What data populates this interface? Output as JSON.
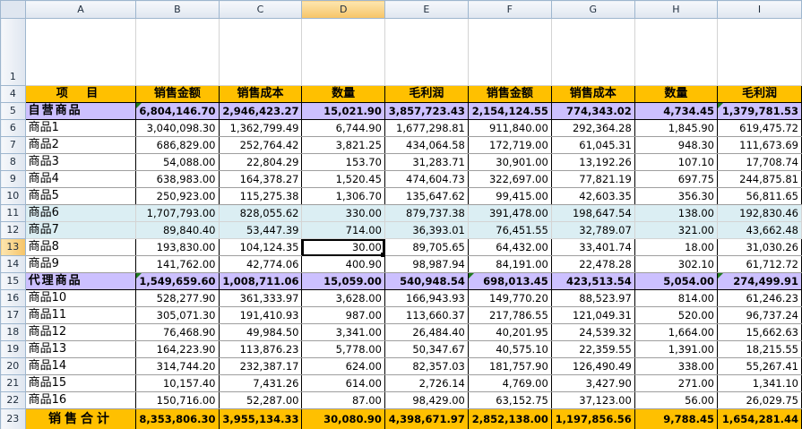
{
  "columns": [
    "A",
    "B",
    "C",
    "D",
    "E",
    "F",
    "G",
    "H",
    "I"
  ],
  "header_row": {
    "row": "4",
    "cells": [
      "项  目",
      "销售金额",
      "销售成本",
      "数量",
      "毛利润",
      "销售金额",
      "销售成本",
      "数量",
      "毛利润"
    ]
  },
  "rows": [
    {
      "row": "5",
      "type": "sub",
      "cells": [
        "自营商品",
        "6,804,146.70",
        "2,946,423.27",
        "15,021.90",
        "3,857,723.43",
        "2,154,124.55",
        "774,343.02",
        "4,734.45",
        "1,379,781.53"
      ]
    },
    {
      "row": "6",
      "type": "data",
      "cells": [
        "商品1",
        "3,040,098.30",
        "1,362,799.49",
        "6,744.90",
        "1,677,298.81",
        "911,840.00",
        "292,364.28",
        "1,845.90",
        "619,475.72"
      ]
    },
    {
      "row": "7",
      "type": "data",
      "cells": [
        "商品2",
        "686,829.00",
        "252,764.42",
        "3,821.25",
        "434,064.58",
        "172,719.00",
        "61,045.31",
        "948.30",
        "111,673.69"
      ]
    },
    {
      "row": "8",
      "type": "data",
      "cells": [
        "商品3",
        "54,088.00",
        "22,804.29",
        "153.70",
        "31,283.71",
        "30,901.00",
        "13,192.26",
        "107.10",
        "17,708.74"
      ]
    },
    {
      "row": "9",
      "type": "data",
      "cells": [
        "商品4",
        "638,983.00",
        "164,378.27",
        "1,520.45",
        "474,604.73",
        "322,697.00",
        "77,821.19",
        "697.75",
        "244,875.81"
      ]
    },
    {
      "row": "10",
      "type": "data",
      "cells": [
        "商品5",
        "250,923.00",
        "115,275.38",
        "1,306.70",
        "135,647.62",
        "99,415.00",
        "42,603.35",
        "356.30",
        "56,811.65"
      ]
    },
    {
      "row": "11",
      "type": "teal",
      "cells": [
        "商品6",
        "1,707,793.00",
        "828,055.62",
        "330.00",
        "879,737.38",
        "391,478.00",
        "198,647.54",
        "138.00",
        "192,830.46"
      ]
    },
    {
      "row": "12",
      "type": "teal",
      "cells": [
        "商品7",
        "89,840.40",
        "53,447.39",
        "714.00",
        "36,393.01",
        "76,451.55",
        "32,789.07",
        "321.00",
        "43,662.48"
      ]
    },
    {
      "row": "13",
      "type": "data",
      "cells": [
        "商品8",
        "193,830.00",
        "104,124.35",
        "30.00",
        "89,705.65",
        "64,432.00",
        "33,401.74",
        "18.00",
        "31,030.26"
      ]
    },
    {
      "row": "14",
      "type": "data",
      "cells": [
        "商品9",
        "141,762.00",
        "42,774.06",
        "400.90",
        "98,987.94",
        "84,191.00",
        "22,478.28",
        "302.10",
        "61,712.72"
      ]
    },
    {
      "row": "15",
      "type": "sub",
      "cells": [
        "代理商品",
        "1,549,659.60",
        "1,008,711.06",
        "15,059.00",
        "540,948.54",
        "698,013.45",
        "423,513.54",
        "5,054.00",
        "274,499.91"
      ]
    },
    {
      "row": "16",
      "type": "data",
      "cells": [
        "商品10",
        "528,277.90",
        "361,333.97",
        "3,628.00",
        "166,943.93",
        "149,770.20",
        "88,523.97",
        "814.00",
        "61,246.23"
      ]
    },
    {
      "row": "17",
      "type": "data",
      "cells": [
        "商品11",
        "305,071.30",
        "191,410.93",
        "987.00",
        "113,660.37",
        "217,786.55",
        "121,049.31",
        "520.00",
        "96,737.24"
      ]
    },
    {
      "row": "18",
      "type": "data",
      "cells": [
        "商品12",
        "76,468.90",
        "49,984.50",
        "3,341.00",
        "26,484.40",
        "40,201.95",
        "24,539.32",
        "1,664.00",
        "15,662.63"
      ]
    },
    {
      "row": "19",
      "type": "data",
      "cells": [
        "商品13",
        "164,223.90",
        "113,876.23",
        "5,778.00",
        "50,347.67",
        "40,575.10",
        "22,359.55",
        "1,391.00",
        "18,215.55"
      ]
    },
    {
      "row": "20",
      "type": "data",
      "cells": [
        "商品14",
        "314,744.20",
        "232,387.17",
        "624.00",
        "82,357.03",
        "181,757.90",
        "126,490.49",
        "338.00",
        "55,267.41"
      ]
    },
    {
      "row": "21",
      "type": "data",
      "cells": [
        "商品15",
        "10,157.40",
        "7,431.26",
        "614.00",
        "2,726.14",
        "4,769.00",
        "3,427.90",
        "271.00",
        "1,341.10"
      ]
    },
    {
      "row": "22",
      "type": "data",
      "cells": [
        "商品16",
        "150,716.00",
        "52,287.00",
        "87.00",
        "98,429.00",
        "63,152.75",
        "37,123.00",
        "56.00",
        "26,029.75"
      ]
    },
    {
      "row": "23",
      "type": "tot",
      "cells": [
        "销售合计",
        "8,353,806.30",
        "3,955,134.33",
        "30,080.90",
        "4,398,671.97",
        "2,852,138.00",
        "1,197,856.56",
        "9,788.45",
        "1,654,281.44"
      ]
    }
  ],
  "first_row_label": "1",
  "selection": {
    "cell": "D13",
    "column": "D",
    "row": "13"
  },
  "colors": {
    "header_bg": "#ffc000",
    "subtotal_bg": "#ccc0ff",
    "highlight_bg": "#dbeef3"
  }
}
